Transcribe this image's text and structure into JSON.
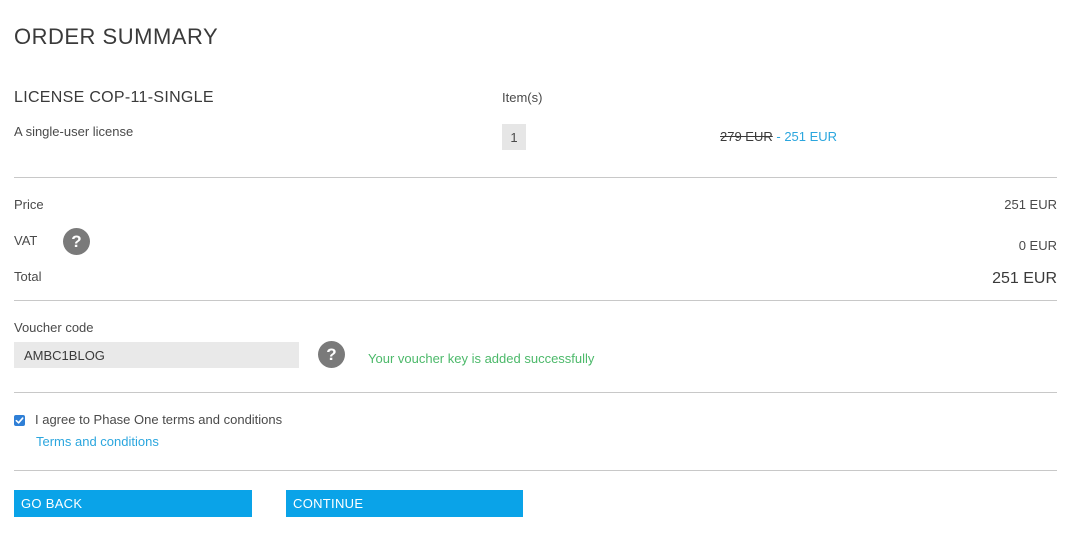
{
  "page_title": "ORDER SUMMARY",
  "product": {
    "name": "LICENSE COP-11-SINGLE",
    "description": "A single-user license",
    "items_header": "Item(s)",
    "quantity": "1",
    "old_price": "279 EUR",
    "price_separator": " - ",
    "new_price": "251 EUR"
  },
  "summary": {
    "price_label": "Price",
    "price_value": "251 EUR",
    "vat_label": "VAT",
    "vat_value": "0 EUR",
    "total_label": "Total",
    "total_value": "251 EUR",
    "help_glyph": "?"
  },
  "voucher": {
    "label": "Voucher code",
    "value": "AMBC1BLOG",
    "help_glyph": "?",
    "message": "Your voucher key is added successfully"
  },
  "terms": {
    "checked": true,
    "agree_text": "I agree to Phase One terms and conditions",
    "link_text": "Terms and conditions"
  },
  "buttons": {
    "back_label": "GO BACK",
    "continue_label": "CONTINUE"
  },
  "colors": {
    "accent_blue": "#0aa3e8",
    "link_blue": "#2ba6de",
    "success_green": "#4cb96a",
    "help_icon_gray": "#7a7a7a",
    "checkbox_blue": "#2f7fd6"
  },
  "icons": {
    "help": "question-circle-icon",
    "checkbox": "checkmark-icon"
  }
}
